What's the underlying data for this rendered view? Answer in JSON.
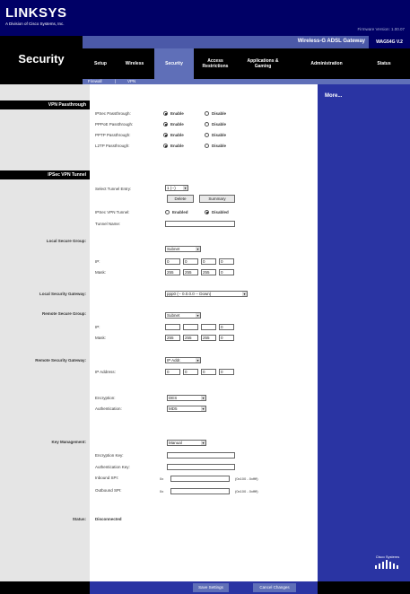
{
  "header": {
    "logo": "LINKSYS",
    "logo_sub": "A Division of Cisco Systems, Inc.",
    "firmware": "Firmware Version: 1.00.07",
    "product_name": "Wireless-G ADSL Gateway",
    "model": "WAG54G V.2",
    "section_title": "Security"
  },
  "nav": {
    "setup": "Setup",
    "wireless": "Wireless",
    "security": "Security",
    "access_restrictions": "Access Restrictions",
    "applications_gaming": "Applications & Gaming",
    "administration": "Administration",
    "status": "Status"
  },
  "subnav": {
    "firewall": "Firewall",
    "sep": "|",
    "vpn": "VPN"
  },
  "sidebar": {
    "more": "More..."
  },
  "vpn_passthrough": {
    "header": "VPN Passthrough",
    "rows": [
      {
        "label": "IPSec Passthrough:",
        "enable": "Enable",
        "disable": "Disable"
      },
      {
        "label": "PPPoE Passthrough:",
        "enable": "Enable",
        "disable": "Disable"
      },
      {
        "label": "PPTP Passthrough:",
        "enable": "Enable",
        "disable": "Disable"
      },
      {
        "label": "L2TP Passthrough:",
        "enable": "Enable",
        "disable": "Disable"
      }
    ]
  },
  "ipsec": {
    "header": "IPSec VPN Tunnel",
    "select_tunnel_label": "Select Tunnel Entry:",
    "select_tunnel_value": "1 (--)",
    "delete_button": "Delete",
    "summary_button": "Summary",
    "tunnel_label": "IPSec VPN Tunnel:",
    "enabled": "Enabled",
    "disabled": "Disabled",
    "tunnel_name_label": "Tunnel Name:"
  },
  "local_group": {
    "left_label": "Local Secure Group:",
    "type_value": "Subnet",
    "ip_label": "IP:",
    "ip": [
      "0",
      "0",
      "0",
      "0"
    ],
    "mask_label": "Mask:",
    "mask": [
      "255",
      "255",
      "255",
      "0"
    ]
  },
  "local_gateway": {
    "left_label": "Local Security Gateway:",
    "value": "ppp0 (-- 0.0.0.0 -- Down)"
  },
  "remote_group": {
    "left_label": "Remote Secure Group:",
    "type_value": "Subnet",
    "ip_label": "IP:",
    "ip": [
      "",
      "",
      "",
      "0"
    ],
    "mask_label": "Mask:",
    "mask": [
      "255",
      "255",
      "255",
      "0"
    ]
  },
  "remote_gateway": {
    "left_label": "Remote Security Gateway:",
    "type_value": "IP Addr.",
    "ip_label": "IP Address:",
    "ip": [
      "0",
      "0",
      "0",
      "0"
    ],
    "encryption_label": "Encryption:",
    "encryption_value": "DES",
    "authentication_label": "Authentication:",
    "authentication_value": "MD5"
  },
  "key_mgmt": {
    "left_label": "Key Management:",
    "type_value": "Manual",
    "encryption_key_label": "Encryption Key:",
    "auth_key_label": "Authentication Key:",
    "inbound_label": "Inbound SPI:",
    "outbound_label": "Outbound SPI:",
    "spi_prefix": "0x",
    "spi_range": "(0x100 - 0xffff)"
  },
  "status": {
    "left_label": "Status:",
    "value": "Disconnected"
  },
  "footer": {
    "save": "Save Settings",
    "cancel": "Cancel Changes",
    "cisco": "Cisco Systems"
  }
}
